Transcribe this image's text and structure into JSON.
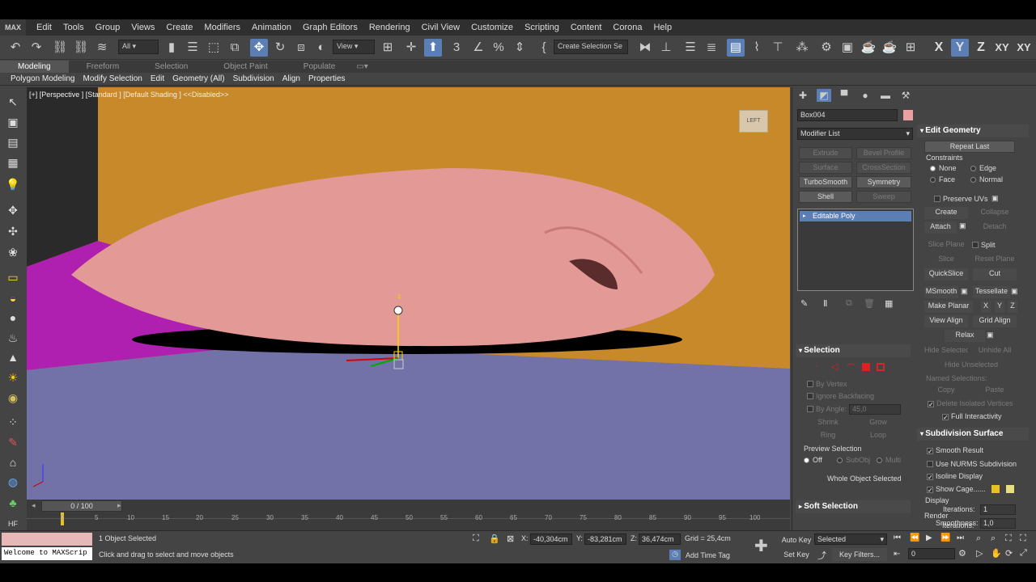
{
  "menu": {
    "logo": "MAX",
    "items": [
      "Edit",
      "Tools",
      "Group",
      "Views",
      "Create",
      "Modifiers",
      "Animation",
      "Graph Editors",
      "Rendering",
      "Civil View",
      "Customize",
      "Scripting",
      "Content",
      "Corona",
      "Help"
    ]
  },
  "toolbar": {
    "selection_filter": "All",
    "reference_coord": "View",
    "named_selection_placeholder": "Create Selection Se",
    "axis_x": "X",
    "axis_y": "Y",
    "axis_z": "Z",
    "axis_xy": "XY",
    "axis_xy2": "XY"
  },
  "ribbon": {
    "tabs": [
      "Modeling",
      "Freeform",
      "Selection",
      "Object Paint",
      "Populate"
    ],
    "subtabs": [
      "Polygon Modeling",
      "Modify Selection",
      "Edit",
      "Geometry (All)",
      "Subdivision",
      "Align",
      "Properties"
    ]
  },
  "viewport": {
    "label": "[+] [Perspective ] [Standard ] [Default Shading ]  <<Disabled>>",
    "viewcube_label": "LEFT",
    "gizmo_axis_label": "z"
  },
  "timeline": {
    "slider_label": "0 / 100",
    "ticks": [
      "0",
      "5",
      "10",
      "15",
      "20",
      "25",
      "30",
      "35",
      "40",
      "45",
      "50",
      "55",
      "60",
      "65",
      "70",
      "75",
      "80",
      "85",
      "90",
      "95",
      "100"
    ]
  },
  "status": {
    "maxscript_text": "Welcome to MAXScrip",
    "selected_text": "1 Object Selected",
    "prompt_text": "Click and drag to select and move objects",
    "x_label": "X:",
    "x_value": "-40,304cm",
    "y_label": "Y:",
    "y_value": "-83,281cm",
    "z_label": "Z:",
    "z_value": "36,474cm",
    "grid_text": "Grid = 25,4cm",
    "add_time_tag": "Add Time Tag",
    "auto_key": "Auto Key",
    "set_key": "Set Key",
    "selected_dropdown": "Selected",
    "key_filters": "Key Filters...",
    "frame_value": "0"
  },
  "command_panel": {
    "object_name": "Box004",
    "object_color": "#e8a0a0",
    "modifier_list": "Modifier List",
    "modifier_buttons": [
      {
        "label": "Extrude",
        "enabled": false
      },
      {
        "label": "Bevel Profile",
        "enabled": false
      },
      {
        "label": "Surface",
        "enabled": false
      },
      {
        "label": "CrossSection",
        "enabled": false
      },
      {
        "label": "TurboSmooth",
        "enabled": true
      },
      {
        "label": "Symmetry",
        "enabled": true
      },
      {
        "label": "Shell",
        "enabled": true
      },
      {
        "label": "Sweep",
        "enabled": false
      }
    ],
    "stack_item": "Editable Poly",
    "selection": {
      "header": "Selection",
      "by_vertex": "By Vertex",
      "ignore_backfacing": "Ignore Backfacing",
      "by_angle": "By Angle:",
      "angle_value": "45,0",
      "shrink": "Shrink",
      "grow": "Grow",
      "ring": "Ring",
      "loop": "Loop",
      "preview_selection": "Preview Selection",
      "off": "Off",
      "subobj": "SubObj",
      "multi": "Multi",
      "whole_object": "Whole Object Selected"
    },
    "soft_selection": "Soft Selection",
    "edit_geometry": {
      "header": "Edit Geometry",
      "repeat_last": "Repeat Last",
      "constraints": "Constraints",
      "none": "None",
      "edge": "Edge",
      "face": "Face",
      "normal": "Normal",
      "preserve_uvs": "Preserve UVs",
      "create": "Create",
      "collapse": "Collapse",
      "attach": "Attach",
      "detach": "Detach",
      "slice_plane": "Slice Plane",
      "split": "Split",
      "slice": "Slice",
      "reset_plane": "Reset Plane",
      "quickslice": "QuickSlice",
      "cut": "Cut",
      "msmooth": "MSmooth",
      "tessellate": "Tessellate",
      "make_planar": "Make Planar",
      "mp_x": "X",
      "mp_y": "Y",
      "mp_z": "Z",
      "view_align": "View Align",
      "grid_align": "Grid Align",
      "relax": "Relax",
      "hide_selected": "Hide Selected",
      "unhide_all": "Unhide All",
      "hide_unselected": "Hide Unselected",
      "named_selections": "Named Selections:",
      "copy": "Copy",
      "paste": "Paste",
      "delete_isolated": "Delete Isolated Vertices",
      "full_interactivity": "Full Interactivity"
    },
    "subdivision": {
      "header": "Subdivision Surface",
      "smooth_result": "Smooth Result",
      "use_nurms": "Use NURMS Subdivision",
      "isoline_display": "Isoline Display",
      "show_cage": "Show Cage......",
      "display": "Display",
      "iterations": "Iterations:",
      "iterations_value": "1",
      "smoothness": "Smoothness:",
      "smoothness_value": "1,0",
      "render": "Render",
      "render_iterations": "Iterations:"
    }
  },
  "colors": {
    "cage_color_1": "#e8c020",
    "cage_color_2": "#e8e080",
    "pillow": "#e39995",
    "floor": "#7070a8",
    "wall": "#c8892a",
    "magenta": "#b020b0"
  }
}
